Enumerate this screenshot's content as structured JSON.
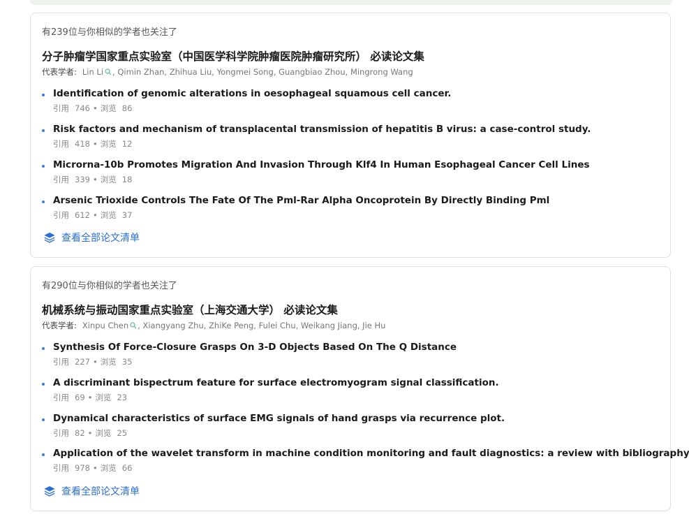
{
  "cards": [
    {
      "similar_text": "有239位与你相似的学者也关注了",
      "title": "分子肿瘤学国家重点实验室（中国医学科学院肿瘤医院肿瘤研究所）  必读论文集",
      "scholars_label": "代表学者:",
      "lead_scholar": "Lin Li",
      "other_scholars": ", Qimin Zhan, Zhihua Liu, Yongmei Song, Guangbiao Zhou, Mingrong Wang",
      "papers": [
        {
          "title": "Identification of genomic alterations in oesophageal squamous cell cancer.",
          "cite_label": "引用",
          "cites": "746",
          "view_label": "浏览",
          "views": "86"
        },
        {
          "title": "Risk factors and mechanism of transplacental transmission of hepatitis B virus: a case-control study.",
          "cite_label": "引用",
          "cites": "418",
          "view_label": "浏览",
          "views": "12"
        },
        {
          "title": "Microrna-10b Promotes Migration And Invasion Through Klf4 In Human Esophageal Cancer Cell Lines",
          "cite_label": "引用",
          "cites": "339",
          "view_label": "浏览",
          "views": "18"
        },
        {
          "title": "Arsenic Trioxide Controls The Fate Of The Pml-Rar Alpha Oncoprotein By Directly Binding Pml",
          "cite_label": "引用",
          "cites": "612",
          "view_label": "浏览",
          "views": "37"
        }
      ],
      "view_all": "查看全部论文清单"
    },
    {
      "similar_text": "有290位与你相似的学者也关注了",
      "title": "机械系统与振动国家重点实验室（上海交通大学）  必读论文集",
      "scholars_label": "代表学者:",
      "lead_scholar": "Xinpu Chen",
      "other_scholars": ", Xiangyang Zhu, ZhiKe Peng, Fulei Chu, Weikang Jiang, Jie Hu",
      "papers": [
        {
          "title": "Synthesis Of Force-Closure Grasps On 3-D Objects Based On The Q Distance",
          "cite_label": "引用",
          "cites": "227",
          "view_label": "浏览",
          "views": "35"
        },
        {
          "title": "A discriminant bispectrum feature for surface electromyogram signal classification.",
          "cite_label": "引用",
          "cites": "69",
          "view_label": "浏览",
          "views": "23"
        },
        {
          "title": "Dynamical characteristics of surface EMG signals of hand grasps via recurrence plot.",
          "cite_label": "引用",
          "cites": "82",
          "view_label": "浏览",
          "views": "25"
        },
        {
          "title": "Application of the wavelet transform in machine condition monitoring and fault diagnostics: a review with bibliography",
          "cite_label": "引用",
          "cites": "978",
          "view_label": "浏览",
          "views": "66"
        }
      ],
      "view_all": "查看全部论文清单"
    }
  ],
  "icons": {
    "magnifier": "search-icon",
    "layers": "layers-icon"
  },
  "colors": {
    "accent": "#2a6fd6",
    "bullet": "#3b7ddd",
    "magnifier": "#5bbf8a",
    "border": "#dcdfe6"
  }
}
